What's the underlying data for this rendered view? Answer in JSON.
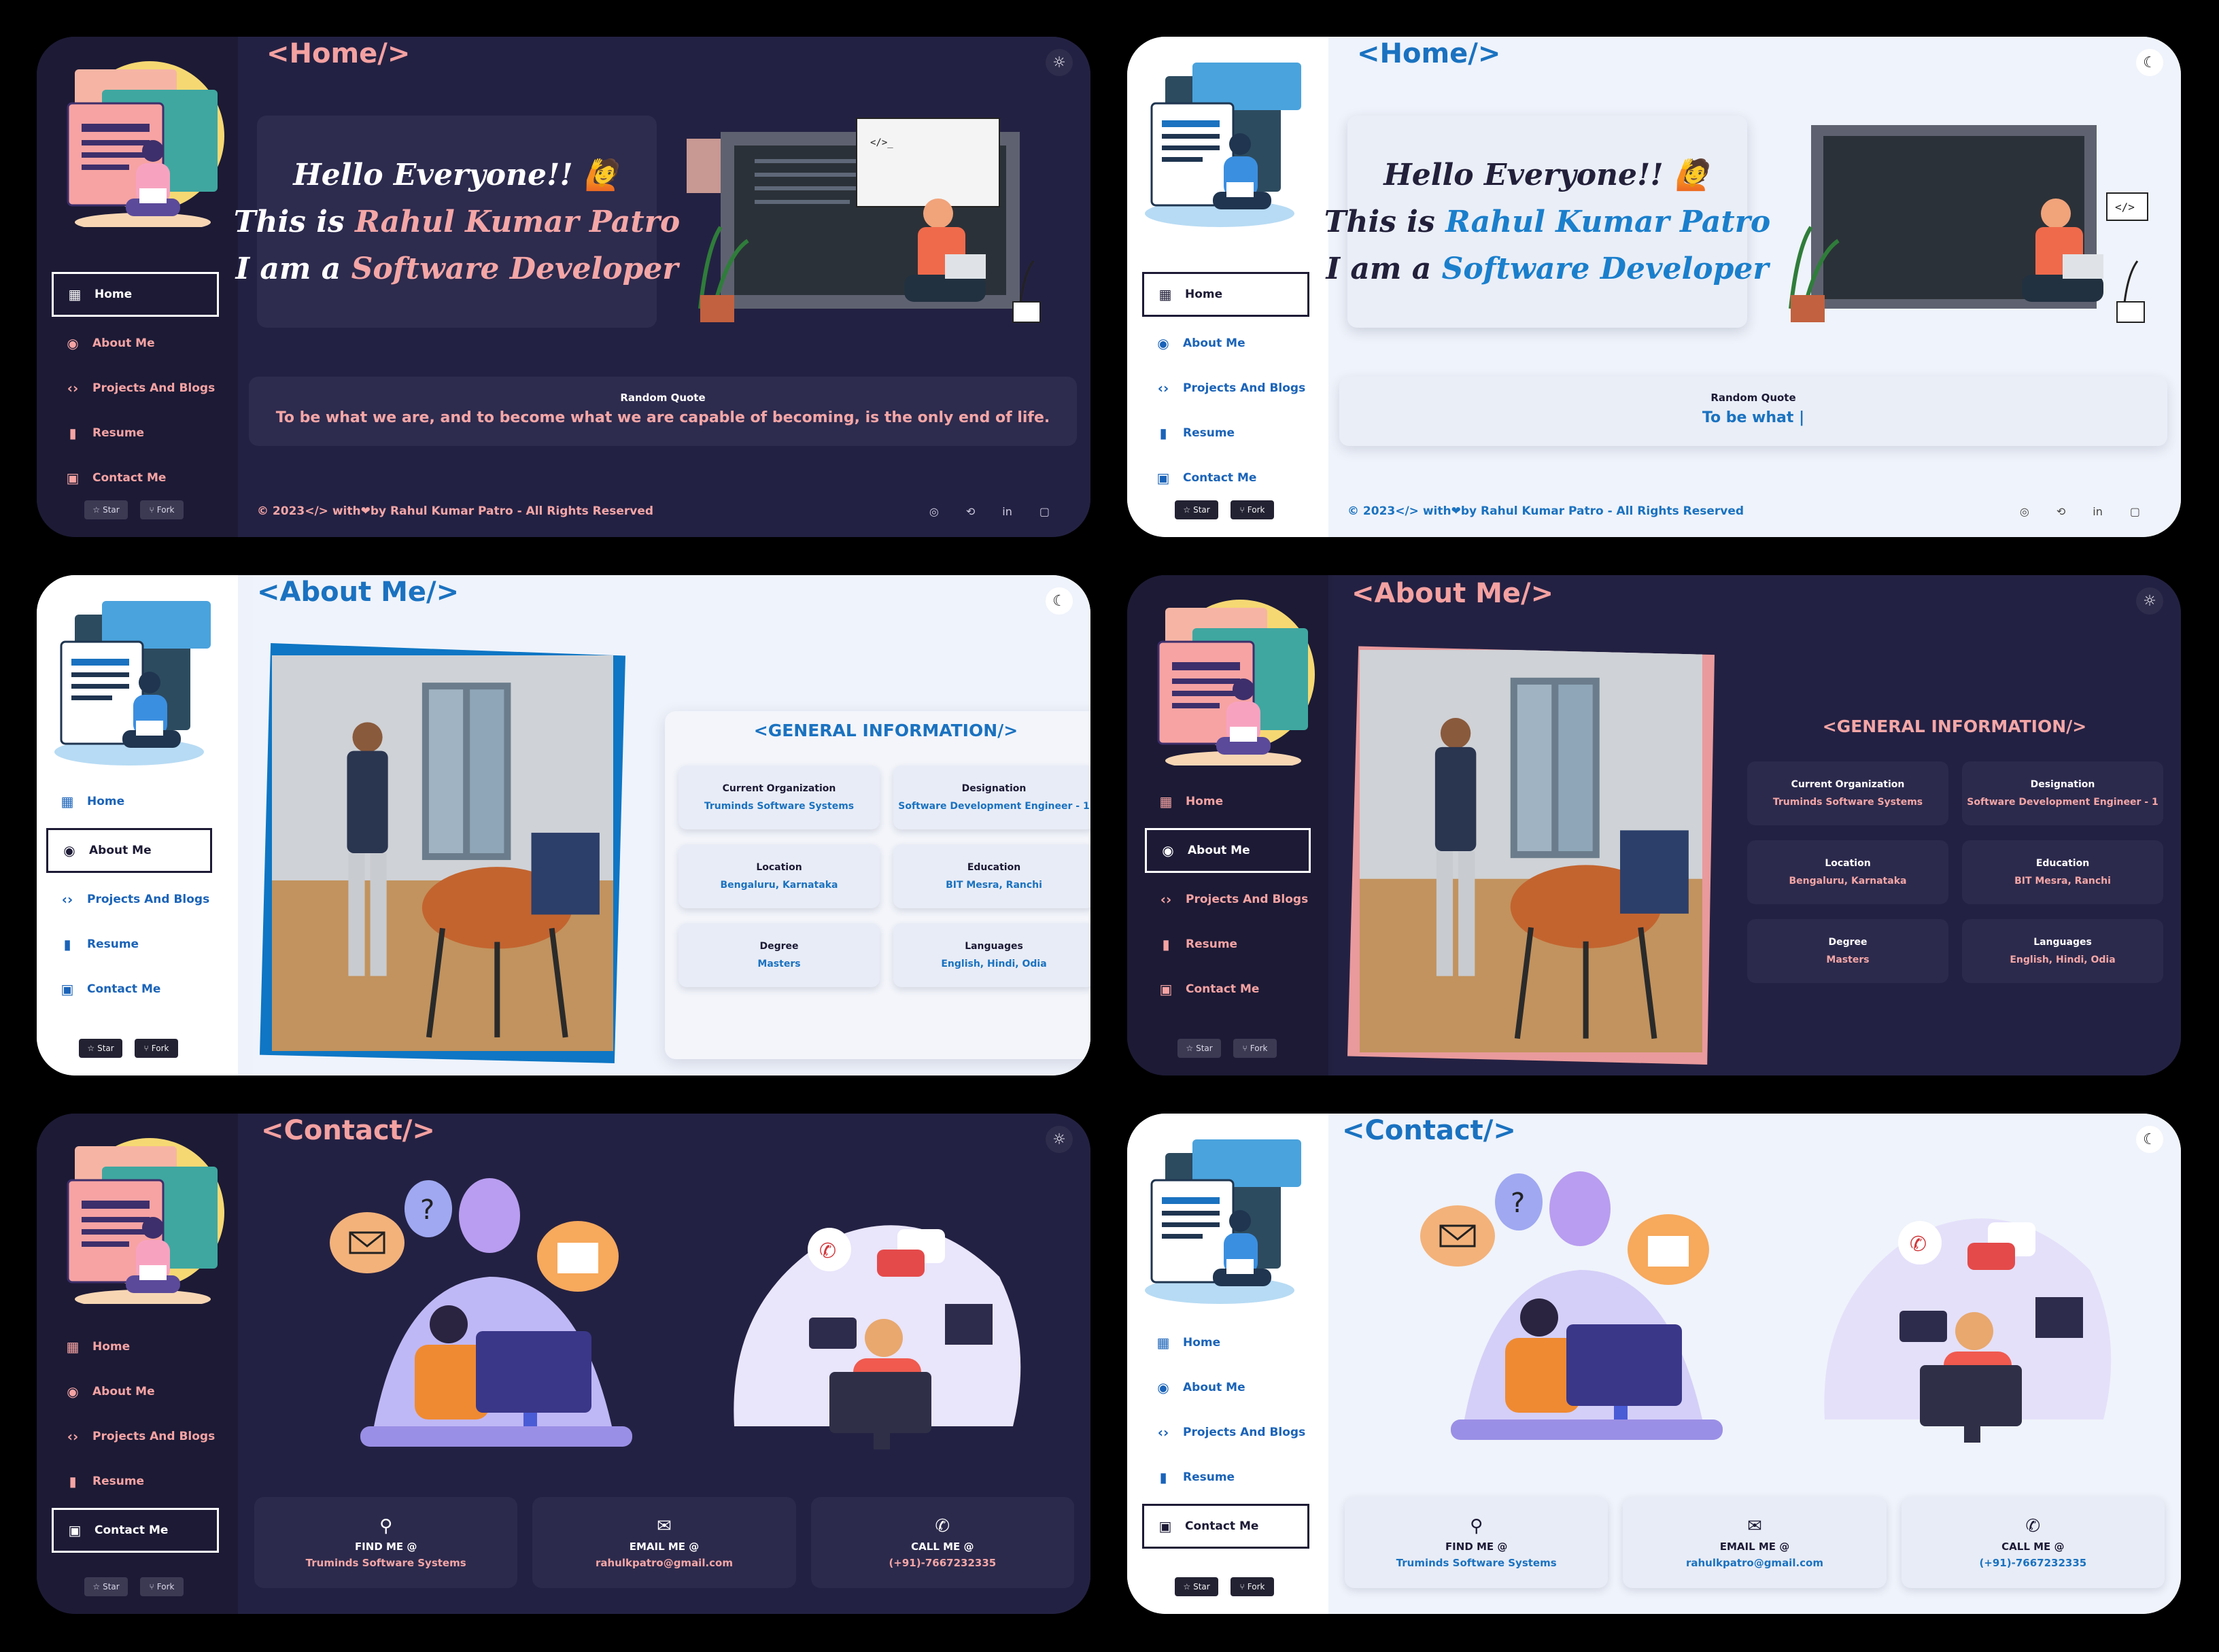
{
  "colors": {
    "dark_bg": "#222040",
    "dark_sidebar": "#1c1a35",
    "dark_accent": "#f4a6a6",
    "light_bg": "#eef2fa",
    "light_accent": "#1a72c0"
  },
  "nav": {
    "home": "Home",
    "about": "About Me",
    "projects": "Projects And Blogs",
    "resume": "Resume",
    "contact": "Contact Me",
    "icons": {
      "home": "grid-icon",
      "about": "user-circle-icon",
      "projects": "code-brackets-icon",
      "resume": "bar-chart-icon",
      "contact": "contact-card-icon"
    }
  },
  "github": {
    "star": "Star",
    "fork": "Fork"
  },
  "titles": {
    "home": "<Home/>",
    "about": "<About Me/>",
    "contact": "<Contact/>"
  },
  "hero": {
    "greeting": "Hello Everyone!! 🙋",
    "intro_prefix": "This is ",
    "name": "Rahul Kumar Patro",
    "role_prefix": "I am a ",
    "role": "Software Developer"
  },
  "quote": {
    "label": "Random Quote",
    "text_full": "To be what we are, and to become what we are capable of becoming, is the only end of life.",
    "text_typing": "To be what |"
  },
  "footer": {
    "text": "© 2023</> with❤by Rahul Kumar Patro - All Rights Reserved"
  },
  "about": {
    "section_title": "<GENERAL INFORMATION/>",
    "items": [
      {
        "label": "Current Organization",
        "value": "Truminds Software Systems"
      },
      {
        "label": "Designation",
        "value": "Software Development Engineer - 1"
      },
      {
        "label": "Location",
        "value": "Bengaluru, Karnataka"
      },
      {
        "label": "Education",
        "value": "BIT Mesra, Ranchi"
      },
      {
        "label": "Degree",
        "value": "Masters"
      },
      {
        "label": "Languages",
        "value": "English, Hindi, Odia"
      }
    ]
  },
  "contact": {
    "find_label": "FIND ME @",
    "find_value": "Truminds Software Systems",
    "email_label": "EMAIL ME @",
    "email_value": "rahulkpatro@gmail.com",
    "call_label": "CALL ME @",
    "call_value": "(+91)-7667232335"
  }
}
